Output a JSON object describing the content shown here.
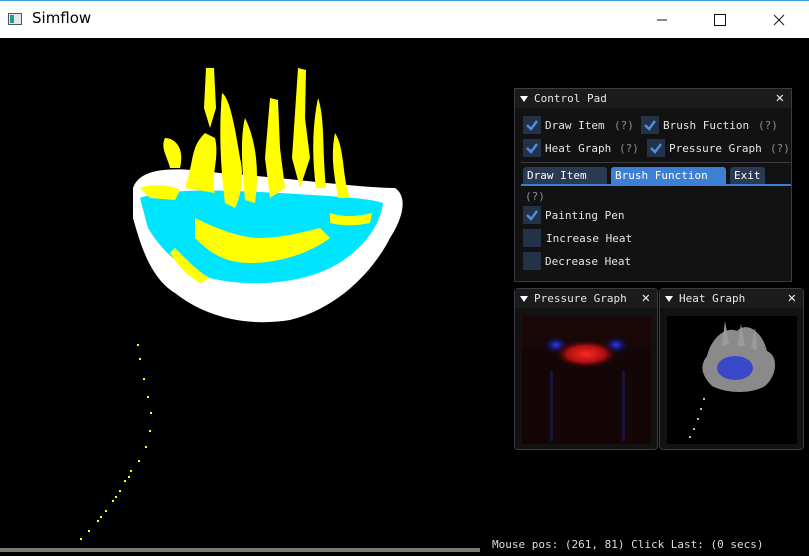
{
  "window": {
    "title": "Simflow"
  },
  "control_pad": {
    "title": "Control Pad",
    "checks": [
      {
        "label": "Draw Item",
        "help": "(?)",
        "checked": true
      },
      {
        "label": "Brush Fuction",
        "help": "(?)",
        "checked": true
      },
      {
        "label": "Heat Graph",
        "help": "(?)",
        "checked": true
      },
      {
        "label": "Pressure Graph",
        "help": "(?)",
        "checked": true
      }
    ],
    "tabs": [
      "Draw Item",
      "Brush Function",
      "Exit"
    ],
    "active_tab": "Brush Function",
    "tab_help": "(?)",
    "brush_options": [
      {
        "label": "Painting Pen",
        "checked": true
      },
      {
        "label": "Increase Heat",
        "checked": false
      },
      {
        "label": "Decrease Heat",
        "checked": false
      }
    ]
  },
  "pressure_graph": {
    "title": "Pressure Graph"
  },
  "heat_graph": {
    "title": "Heat Graph"
  },
  "status": {
    "text": "Mouse pos: (261, 81) Click Last: (0 secs)"
  },
  "colors": {
    "accent": "#3d7fd4",
    "fluid_yellow": "#ffff00",
    "fluid_cyan": "#00e5ff",
    "fluid_white": "#ffffff"
  }
}
